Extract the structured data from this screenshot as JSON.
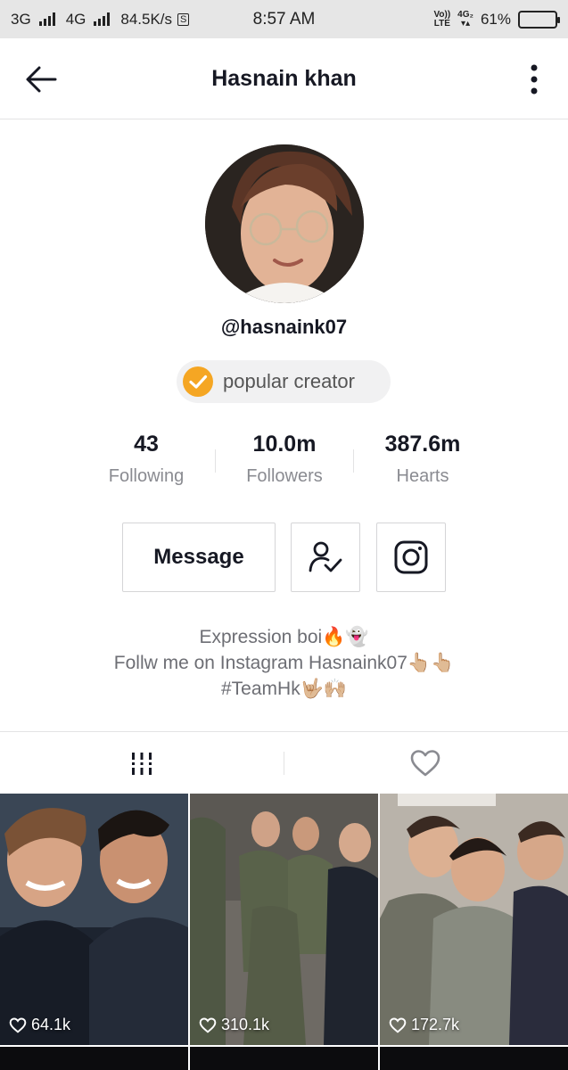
{
  "status_bar": {
    "left": {
      "net1": "3G",
      "net2": "4G",
      "speed": "84.5K/s",
      "sim_icon": "S"
    },
    "time": "8:57 AM",
    "right": {
      "volte_top": "Vo))",
      "volte_bottom": "LTE",
      "net_top": "4G₂",
      "battery_pct": "61%",
      "battery_level": 0.61
    }
  },
  "header": {
    "title": "Hasnain khan",
    "back_icon": "arrow-left-icon",
    "more_icon": "more-vertical-icon"
  },
  "profile": {
    "username": "@hasnaink07",
    "badge": {
      "label": "popular creator",
      "color": "#f5a623"
    },
    "stats": [
      {
        "value": "43",
        "label": "Following"
      },
      {
        "value": "10.0m",
        "label": "Followers"
      },
      {
        "value": "387.6m",
        "label": "Hearts"
      }
    ],
    "buttons": {
      "message": "Message",
      "follow_icon": "user-check-icon",
      "instagram_icon": "instagram-icon"
    },
    "bio": [
      "Expression boi🔥👻",
      "Follw me on Instagram Hasnaink07👆🏼👆🏼",
      "#TeamHk🤟🏼🙌🏼"
    ]
  },
  "tabs": [
    {
      "name": "videos",
      "icon": "grid-bars-icon",
      "active": true
    },
    {
      "name": "liked",
      "icon": "heart-outline-icon",
      "active": false
    }
  ],
  "videos": [
    {
      "likes": "64.1k"
    },
    {
      "likes": "310.1k"
    },
    {
      "likes": "172.7k"
    }
  ],
  "colors": {
    "accent_badge": "#f5a623",
    "text_primary": "#161823",
    "text_secondary": "#8a8b91"
  }
}
